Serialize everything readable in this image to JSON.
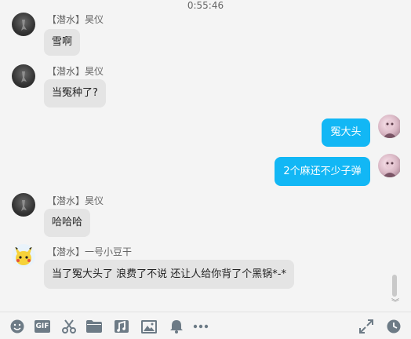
{
  "chat": {
    "timestamp": "0:55:46",
    "messages": [
      {
        "sender": "【潜水】昊仪",
        "text": "雪啊",
        "direction": "in",
        "avatar": "dark-avatar"
      },
      {
        "sender": "【潜水】昊仪",
        "text": "当冤种了?",
        "direction": "in",
        "avatar": "dark-avatar"
      },
      {
        "text": "冤大头",
        "direction": "out",
        "avatar": "flower-avatar"
      },
      {
        "text": "2个麻还不少子弹",
        "direction": "out",
        "avatar": "flower-avatar"
      },
      {
        "sender": "【潜水】昊仪",
        "text": "哈哈哈",
        "direction": "in",
        "avatar": "dark-avatar"
      },
      {
        "sender": "【潜水】一号小豆干",
        "text": "当了冤大头了  浪费了不说 还让人给你背了个黑锅*-*",
        "direction": "in",
        "avatar": "pikachu-avatar"
      }
    ]
  },
  "toolbar": {
    "gif_label": "GIF",
    "left_icons": [
      "emoji-icon",
      "gif-icon",
      "scissors-icon",
      "folder-icon",
      "music-icon",
      "image-icon",
      "bell-icon",
      "more-icon"
    ],
    "right_icons": [
      "expand-icon",
      "history-clock-icon"
    ]
  },
  "colors": {
    "incoming_bubble": "#e4e4e4",
    "outgoing_bubble": "#12b7f5",
    "icon": "#6d7b86"
  }
}
